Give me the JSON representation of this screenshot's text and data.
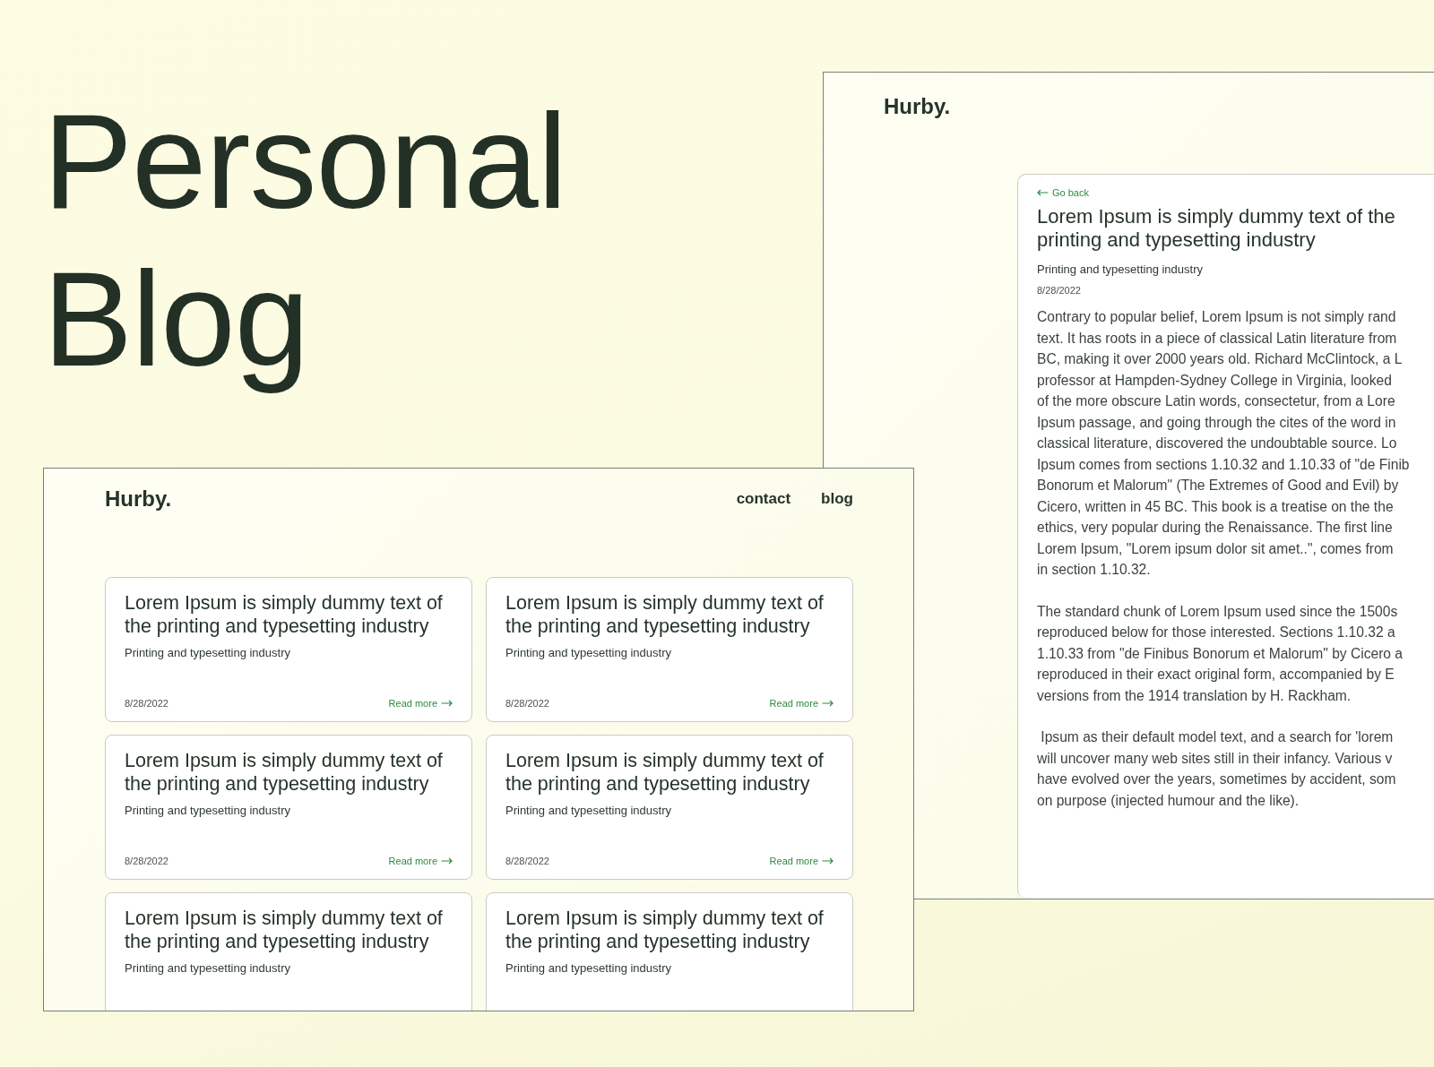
{
  "headline": [
    "Personal",
    "Blog"
  ],
  "article_page": {
    "logo": "Hurby.",
    "back_link": "Go back",
    "title": "Lorem Ipsum is simply dummy text of the printing and typesetting industry",
    "subtitle": "Printing and typesetting industry",
    "date": "8/28/2022",
    "paragraphs": [
      [
        "Contrary to popular belief, Lorem Ipsum is not simply rand",
        "text. It has roots in a piece of classical Latin literature from",
        "BC, making it over 2000 years old. Richard McClintock, a L",
        "professor at Hampden-Sydney College in Virginia, looked",
        "of the more obscure Latin words, consectetur, from a Lore",
        "Ipsum passage, and going through the cites of the word in",
        "classical literature, discovered the undoubtable source. Lo",
        "Ipsum comes from sections 1.10.32 and 1.10.33 of \"de Finib",
        "Bonorum et Malorum\" (The Extremes of Good and Evil) by",
        "Cicero, written in 45 BC. This book is a treatise on the the",
        "ethics, very popular during the Renaissance. The first line",
        "Lorem Ipsum, \"Lorem ipsum dolor sit amet..\", comes from",
        "in section 1.10.32."
      ],
      [
        "The standard chunk of Lorem Ipsum used since the 1500s",
        "reproduced below for those interested. Sections 1.10.32 a",
        "1.10.33 from \"de Finibus Bonorum et Malorum\" by Cicero a",
        "reproduced in their exact original form, accompanied by E",
        "versions from the 1914 translation by H. Rackham."
      ],
      [
        " Ipsum as their default model text, and a search for 'lorem",
        "will uncover many web sites still in their infancy. Various v",
        "have evolved over the years, sometimes by accident, som",
        "on purpose (injected humour and the like)."
      ]
    ]
  },
  "list_page": {
    "logo": "Hurby.",
    "nav": [
      "contact",
      "blog"
    ],
    "cards": [
      {
        "title": "Lorem Ipsum is simply dummy text of the printing and typesetting industry",
        "subtitle": "Printing and typesetting industry",
        "date": "8/28/2022",
        "read_more": "Read more"
      },
      {
        "title": "Lorem Ipsum is simply dummy text of the printing and typesetting industry",
        "subtitle": "Printing and typesetting industry",
        "date": "8/28/2022",
        "read_more": "Read more"
      },
      {
        "title": "Lorem Ipsum is simply dummy text of the printing and typesetting industry",
        "subtitle": "Printing and typesetting industry",
        "date": "8/28/2022",
        "read_more": "Read more"
      },
      {
        "title": "Lorem Ipsum is simply dummy text of the printing and typesetting industry",
        "subtitle": "Printing and typesetting industry",
        "date": "8/28/2022",
        "read_more": "Read more"
      },
      {
        "title": "Lorem Ipsum is simply dummy text of the printing and typesetting industry",
        "subtitle": "Printing and typesetting industry"
      },
      {
        "title": "Lorem Ipsum is simply dummy text of the printing and typesetting industry",
        "subtitle": "Printing and typesetting industry"
      }
    ]
  }
}
